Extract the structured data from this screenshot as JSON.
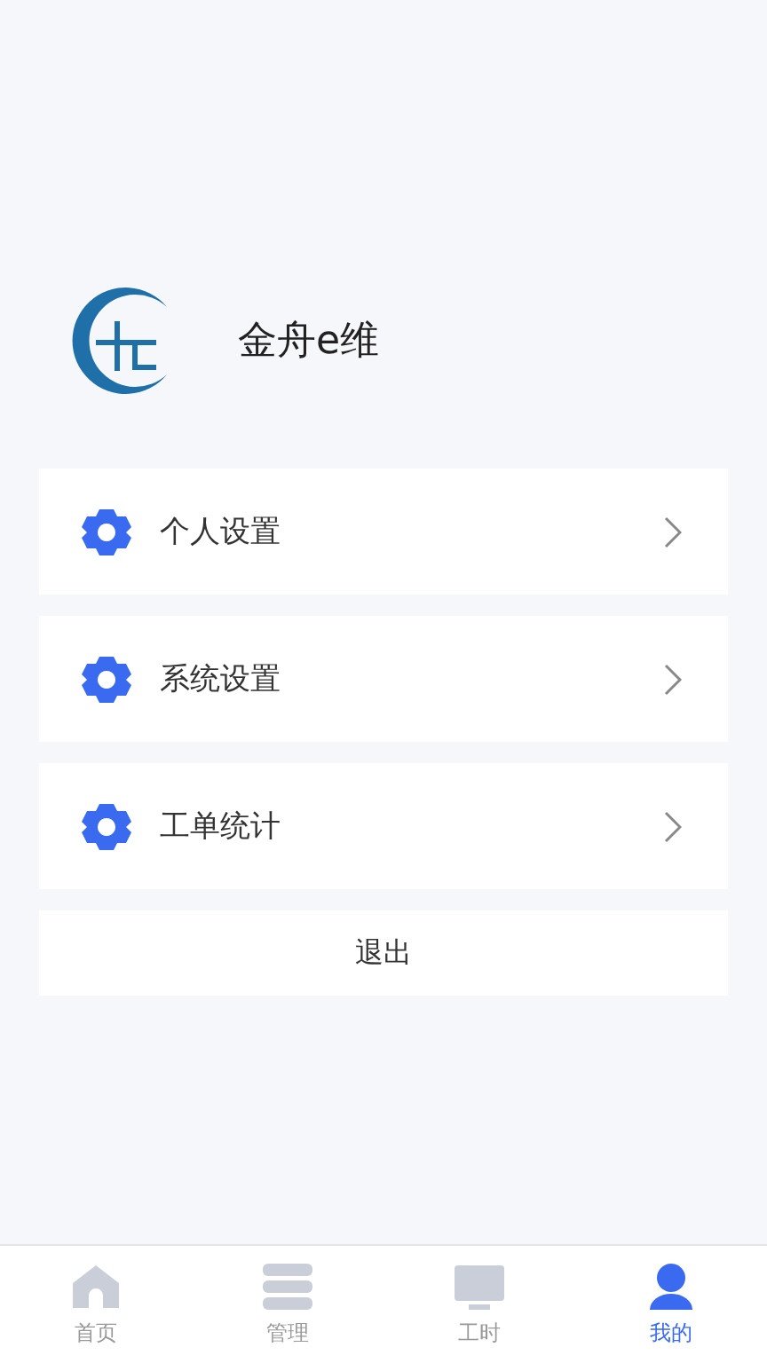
{
  "app": {
    "name": "金舟e维"
  },
  "menu": [
    {
      "label": "个人设置"
    },
    {
      "label": "系统设置"
    },
    {
      "label": "工单统计"
    }
  ],
  "logout": {
    "label": "退出"
  },
  "tab_bar": [
    {
      "label": "首页",
      "selected": false
    },
    {
      "label": "管理",
      "selected": false
    },
    {
      "label": "工时",
      "selected": false
    },
    {
      "label": "我的",
      "selected": true
    }
  ]
}
